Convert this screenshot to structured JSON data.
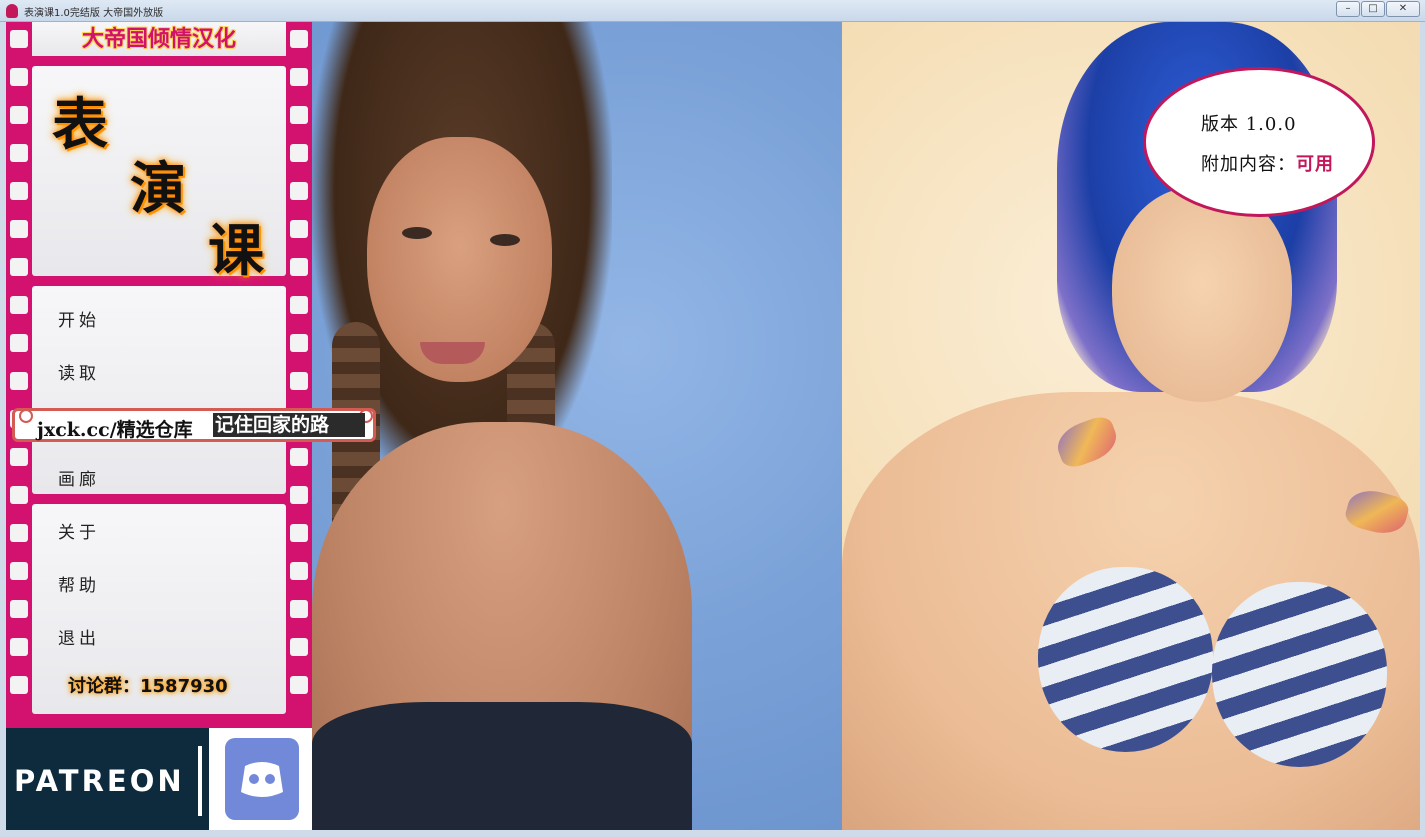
{
  "window": {
    "title": "表演课1.0完结版 大帝国外放版",
    "minimize_glyph": "–",
    "maximize_glyph": "□",
    "close_glyph": "✕"
  },
  "film_panel": {
    "banner": "大帝国倾情汉化",
    "logo_chars": [
      "表",
      "演",
      "课"
    ],
    "menu": {
      "start": "开始",
      "load": "读取",
      "gallery": "画廊",
      "about": "关于",
      "help": "帮助",
      "quit": "退出"
    },
    "group_label": "讨论群：1587930"
  },
  "watermark": {
    "text": "jxck.cc/精选仓库",
    "highlight": "记住回家的路"
  },
  "social": {
    "patreon": "PATREON",
    "discord_icon": "discord-icon"
  },
  "version_bubble": {
    "version_label": "版本 1.0.0",
    "dlc_label": "附加内容：",
    "dlc_value": "可用"
  },
  "colors": {
    "accent": "#c2185b",
    "film": "#d3126f",
    "patreon_bg": "#0e2a3d",
    "discord": "#7289da"
  }
}
